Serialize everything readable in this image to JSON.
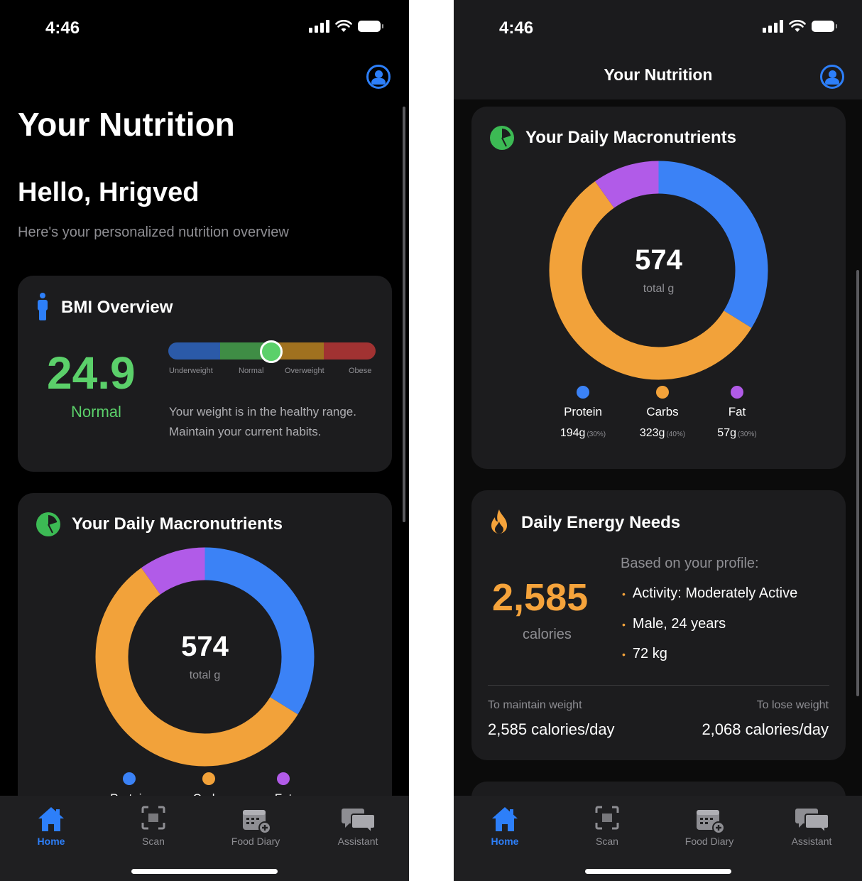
{
  "status": {
    "time": "4:46"
  },
  "left": {
    "title": "Your Nutrition",
    "greeting": "Hello, Hrigved",
    "subtitle": "Here's your personalized nutrition overview"
  },
  "right": {
    "nav_title": "Your Nutrition"
  },
  "bmi": {
    "title": "BMI Overview",
    "value": "24.9",
    "category": "Normal",
    "scale_labels": [
      "Underweight",
      "Normal",
      "Overweight",
      "Obese"
    ],
    "scale_colors": [
      "#2b5aa8",
      "#3f8d45",
      "#a0711f",
      "#a13232"
    ],
    "marker_color": "#5bd06a",
    "description_line1": "Your weight is in the healthy range.",
    "description_line2": "Maintain your current habits."
  },
  "macros": {
    "title": "Your Daily Macronutrients",
    "total": "574",
    "total_unit": "total g",
    "items": [
      {
        "name": "Protein",
        "grams": "194g",
        "pct": "(30%)",
        "color": "#3b82f6"
      },
      {
        "name": "Carbs",
        "grams": "323g",
        "pct": "(40%)",
        "color": "#f2a23a"
      },
      {
        "name": "Fat",
        "grams": "57g",
        "pct": "(30%)",
        "color": "#b15be8"
      }
    ],
    "donut_fractions": [
      0.338,
      0.563,
      0.099
    ]
  },
  "energy": {
    "title": "Daily Energy Needs",
    "calories": "2,585",
    "unit": "calories",
    "profile_heading": "Based on your profile:",
    "bullets": [
      "Activity: Moderately Active",
      "Male, 24 years",
      "72 kg"
    ],
    "maintain_label": "To maintain weight",
    "maintain_value": "2,585 calories/day",
    "lose_label": "To lose weight",
    "lose_value": "2,068 calories/day"
  },
  "tabs": [
    {
      "label": "Home",
      "icon": "house-icon",
      "active": true
    },
    {
      "label": "Scan",
      "icon": "scan-icon",
      "active": false
    },
    {
      "label": "Food Diary",
      "icon": "calendar-plus-icon",
      "active": false
    },
    {
      "label": "Assistant",
      "icon": "chat-bubbles-icon",
      "active": false
    }
  ],
  "colors": {
    "accent": "#2d7ff9",
    "positive": "#5bd06a",
    "energy": "#f5a33b"
  }
}
